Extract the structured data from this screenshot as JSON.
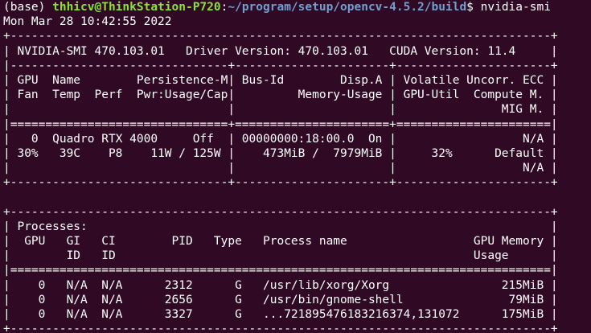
{
  "prompt": {
    "env": "(base) ",
    "user_host": "thhicv@ThinkStation-P720",
    "sep": ":",
    "cwd": "~/program/setup/opencv-4.5.2/build",
    "dollar": "$ ",
    "command": "nvidia-smi"
  },
  "timestamp": "Mon Mar 28 10:42:55 2022",
  "gpu_table": {
    "lines": [
      "+-----------------------------------------------------------------------------+",
      "| NVIDIA-SMI 470.103.01   Driver Version: 470.103.01   CUDA Version: 11.4     |",
      "|-------------------------------+----------------------+----------------------+",
      "| GPU  Name        Persistence-M| Bus-Id        Disp.A | Volatile Uncorr. ECC |",
      "| Fan  Temp  Perf  Pwr:Usage/Cap|         Memory-Usage | GPU-Util  Compute M. |",
      "|                               |                      |               MIG M. |",
      "|===============================+======================+======================|",
      "|   0  Quadro RTX 4000     Off  | 00000000:18:00.0  On |                  N/A |",
      "| 30%   39C    P8    11W / 125W |    473MiB /  7979MiB |     32%      Default |",
      "|                               |                      |                  N/A |",
      "+-------------------------------+----------------------+----------------------+"
    ]
  },
  "blank_line": " ",
  "process_table": {
    "lines": [
      "+-----------------------------------------------------------------------------+",
      "| Processes:                                                                  |",
      "|  GPU   GI   CI        PID   Type   Process name                  GPU Memory |",
      "|        ID   ID                                                   Usage      |",
      "|=============================================================================|",
      "|    0   N/A  N/A      2312      G   /usr/lib/xorg/Xorg                215MiB |",
      "|    0   N/A  N/A      2656      G   /usr/bin/gnome-shell               79MiB |",
      "|    0   N/A  N/A      3327      G   ...721895476183216374,131072      175MiB |",
      "+-----------------------------------------------------------------------------+"
    ]
  },
  "colors": {
    "background": "#300a24",
    "text": "#ffffff",
    "user_host": "#8ae234",
    "path": "#729fcf"
  }
}
